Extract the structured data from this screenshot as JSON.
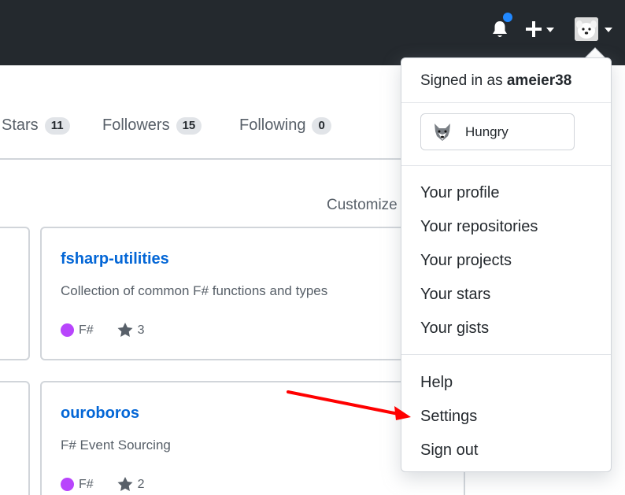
{
  "header": {
    "notifications_icon": "bell-icon",
    "create_icon": "plus-icon",
    "avatar_icon": "user-avatar",
    "colors": {
      "background": "#24292e",
      "notification_dot": "#2188ff"
    }
  },
  "profile_nav": {
    "items": [
      {
        "label": "Stars",
        "count": "11"
      },
      {
        "label": "Followers",
        "count": "15"
      },
      {
        "label": "Following",
        "count": "0"
      }
    ]
  },
  "customize_label": "Customize",
  "repos": [
    {
      "name": "fsharp-utilities",
      "description": "Collection of common F# functions and types",
      "language": "F#",
      "stars": "3",
      "language_color": "#b845fc"
    },
    {
      "name": "ouroboros",
      "description": "F# Event Sourcing",
      "language": "F#",
      "stars": "2",
      "language_color": "#b845fc"
    }
  ],
  "dropdown": {
    "signed_in_prefix": "Signed in as",
    "username": "ameier38",
    "status": {
      "emoji": "wolf-face-icon",
      "text": "Hungry"
    },
    "menu_group_1": [
      "Your profile",
      "Your repositories",
      "Your projects",
      "Your stars",
      "Your gists"
    ],
    "menu_group_2": [
      "Help",
      "Settings",
      "Sign out"
    ]
  },
  "annotation": {
    "type": "arrow",
    "color": "#ff0000",
    "target": "Settings"
  }
}
